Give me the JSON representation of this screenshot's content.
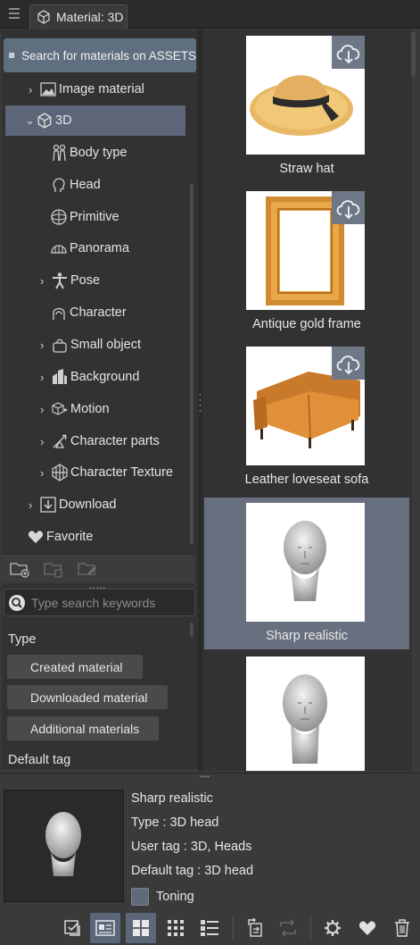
{
  "window": {
    "title": "Material: 3D"
  },
  "assets_search": {
    "label": "Search for materials on ASSETS"
  },
  "tree": {
    "items": [
      {
        "label": "Image material",
        "chevron": "›"
      },
      {
        "label": "3D",
        "chevron": "⌄"
      },
      {
        "label": "Body type",
        "chevron": ""
      },
      {
        "label": "Head",
        "chevron": ""
      },
      {
        "label": "Primitive",
        "chevron": ""
      },
      {
        "label": "Panorama",
        "chevron": ""
      },
      {
        "label": "Pose",
        "chevron": "›"
      },
      {
        "label": "Character",
        "chevron": ""
      },
      {
        "label": "Small object",
        "chevron": "›"
      },
      {
        "label": "Background",
        "chevron": "›"
      },
      {
        "label": "Motion",
        "chevron": "›"
      },
      {
        "label": "Character parts",
        "chevron": "›"
      },
      {
        "label": "Character Texture",
        "chevron": "›"
      },
      {
        "label": "Download",
        "chevron": "›"
      },
      {
        "label": "Favorite",
        "chevron": ""
      }
    ]
  },
  "search": {
    "placeholder": "Type search keywords"
  },
  "filters": {
    "type_heading": "Type",
    "buttons": [
      "Created material",
      "Downloaded material",
      "Additional materials"
    ],
    "default_tag_heading": "Default tag"
  },
  "materials": [
    {
      "name": "Straw hat",
      "downloadable": true
    },
    {
      "name": "Antique gold frame",
      "downloadable": true
    },
    {
      "name": "Leather loveseat sofa",
      "downloadable": true
    },
    {
      "name": "Sharp realistic",
      "downloadable": false,
      "selected": true
    },
    {
      "name": "",
      "downloadable": false
    }
  ],
  "info": {
    "name": "Sharp realistic",
    "type": "Type : 3D head",
    "user_tag": "User tag : 3D, Heads",
    "default_tag": "Default tag : 3D head",
    "toning": "Toning"
  },
  "colors": {
    "selection": "#5c6678",
    "accent_blue": "#5f6f7f"
  },
  "icons": [
    "menu-icon",
    "cube-icon",
    "assets-logo-icon",
    "image-icon",
    "body-type-icon",
    "head-icon",
    "primitive-icon",
    "panorama-icon",
    "pose-icon",
    "character-icon",
    "small-object-icon",
    "background-icon",
    "motion-icon",
    "character-parts-icon",
    "character-texture-icon",
    "download-icon",
    "heart-icon",
    "cloud-download-icon"
  ]
}
